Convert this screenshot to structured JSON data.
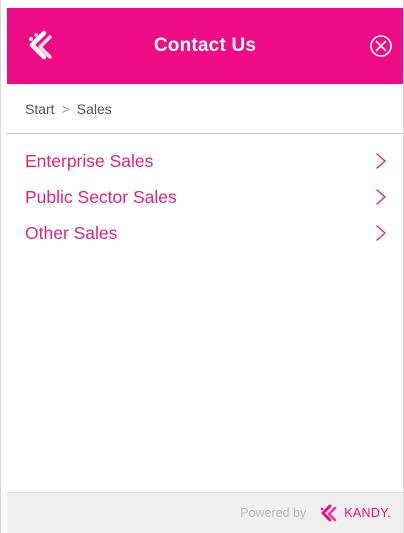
{
  "header": {
    "title": "Contact Us",
    "back_icon": "kandy-back-icon",
    "close_icon": "close-circle-icon"
  },
  "breadcrumb": {
    "items": [
      "Start",
      "Sales"
    ],
    "separator": ">"
  },
  "menu": {
    "items": [
      {
        "label": "Enterprise Sales"
      },
      {
        "label": "Public Sector Sales"
      },
      {
        "label": "Other Sales"
      }
    ]
  },
  "footer": {
    "powered_by": "Powered by",
    "brand": "KANDY."
  },
  "colors": {
    "accent": "#ee0b85",
    "link": "#e0237f",
    "footer_bg": "#efefef"
  }
}
